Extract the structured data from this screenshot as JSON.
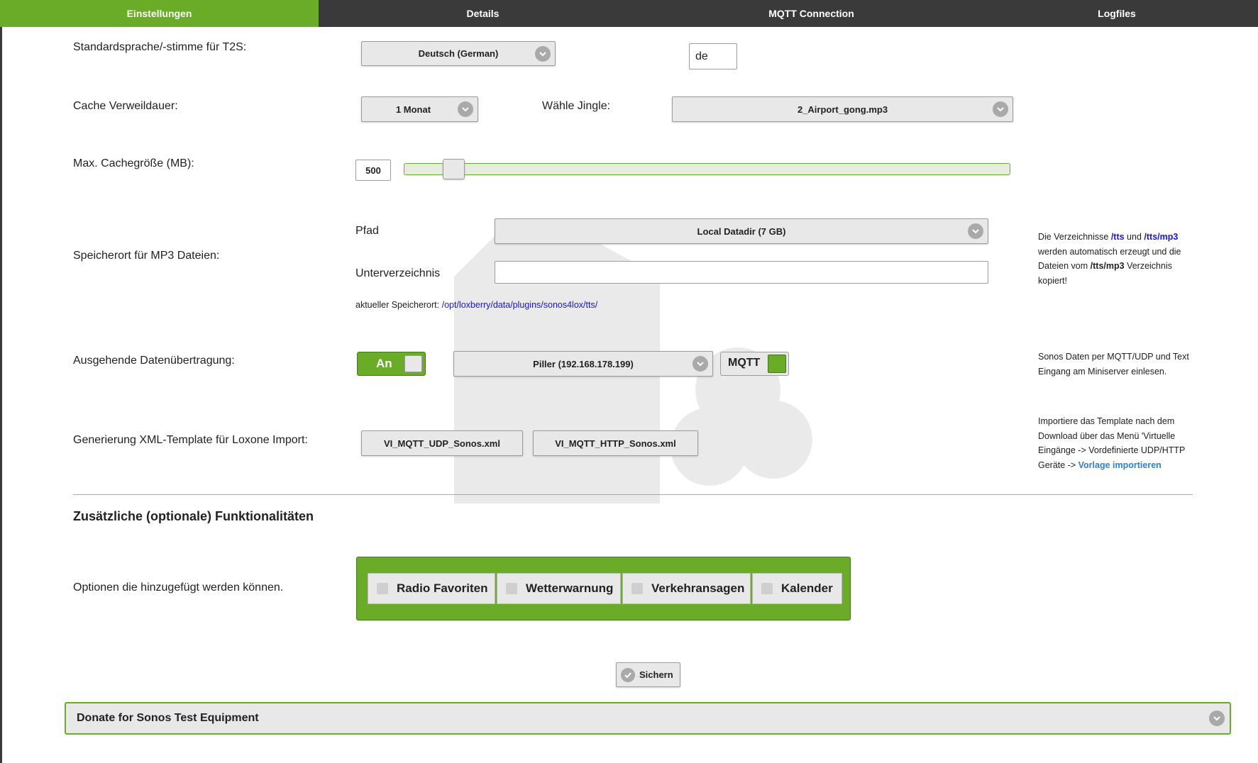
{
  "nav": {
    "tabs": [
      {
        "label": "Einstellungen"
      },
      {
        "label": "Details"
      },
      {
        "label": "MQTT Connection"
      },
      {
        "label": "Logfiles"
      }
    ]
  },
  "t2s": {
    "label": "Standardsprache/-stimme für T2S:",
    "voice_select": "Deutsch (German)",
    "lang_code": "de"
  },
  "cache": {
    "label": "Cache Verweildauer:",
    "duration_select": "1 Monat",
    "jingle_label": "Wähle Jingle:",
    "jingle_select": "2_Airport_gong.mp3"
  },
  "cachesize": {
    "label": "Max. Cachegröße (MB):",
    "value": "500",
    "slider_fraction": 0.08
  },
  "storage": {
    "label": "Speicherort für MP3 Dateien:",
    "path_label": "Pfad",
    "path_select": "Local Datadir (7 GB)",
    "subdir_label": "Unterverzeichnis",
    "subdir_value": "",
    "current_label": "aktueller Speicherort:",
    "current_path": "/opt/loxberry/data/plugins/sonos4lox/tts/",
    "note": {
      "p1": "Die Verzeichnisse ",
      "tts": "/tts",
      "p2": " und ",
      "mp3": "/tts/mp3",
      "p3": " werden automatisch erzeugt und die Dateien vom ",
      "mp3b": "/tts/mp3",
      "p4": " Verzeichnis kopiert!"
    }
  },
  "transfer": {
    "label": "Ausgehende Datenübertragung:",
    "toggle_label": "An",
    "miniserver_select": "Piller (192.168.178.199)",
    "mqtt_label": "MQTT",
    "note": "Sonos Daten per MQTT/UDP und Text Eingang am Miniserver einlesen."
  },
  "xml": {
    "label": "Generierung XML-Template für Loxone Import:",
    "button1": "VI_MQTT_UDP_Sonos.xml",
    "button2": "VI_MQTT_HTTP_Sonos.xml",
    "note": "Importiere das Template nach dem Download über das Menü 'Virtuelle Eingänge -> Vordefinierte UDP/HTTP Geräte -> ",
    "note_link": "Vorlage importieren"
  },
  "extras": {
    "heading": "Zusätzliche (optionale) Funktionalitäten",
    "label": "Optionen die hinzugefügt werden können.",
    "options": [
      {
        "label": "Radio Favoriten"
      },
      {
        "label": "Wetterwarnung"
      },
      {
        "label": "Verkehransagen"
      },
      {
        "label": "Kalender"
      }
    ]
  },
  "save_label": "Sichern",
  "donate_label": "Donate for Sonos Test Equipment",
  "colors": {
    "accent": "#6aab27",
    "nav": "#3a3a3a",
    "link_blue": "#1515e8"
  }
}
